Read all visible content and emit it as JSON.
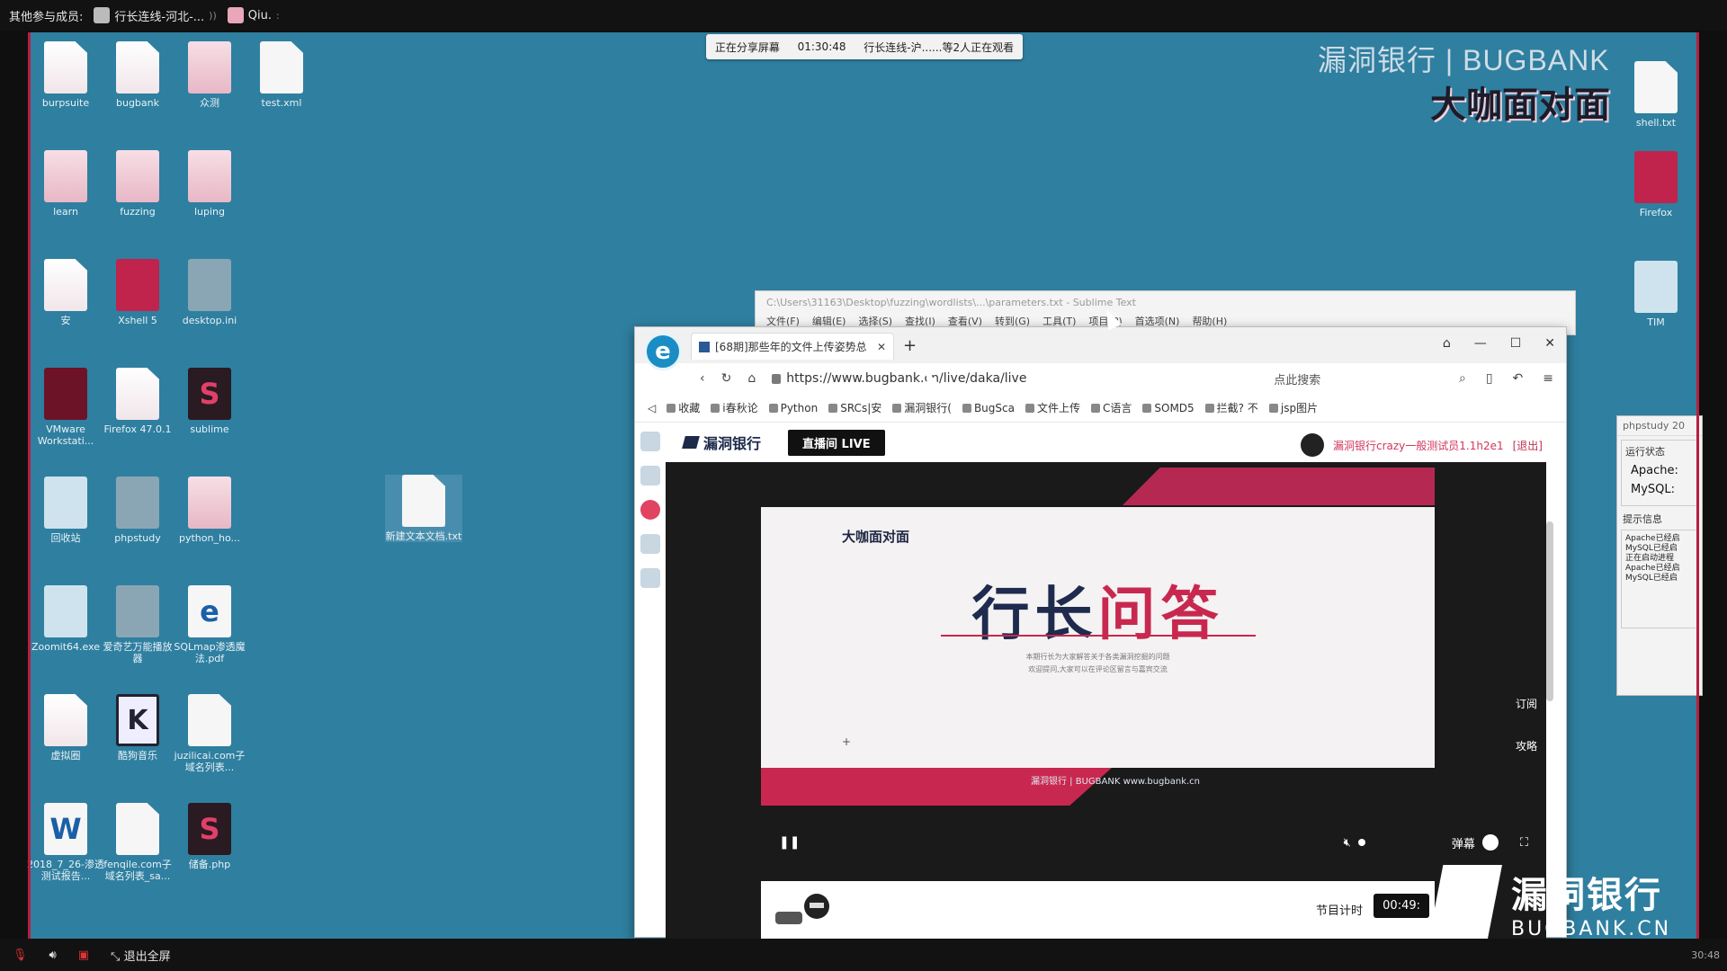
{
  "topbar": {
    "others_label": "其他参与成员:",
    "members": [
      {
        "name": "行长连线-河北-..."
      },
      {
        "name": "Qiu."
      }
    ]
  },
  "share_banner": {
    "status": "正在分享屏幕",
    "elapsed": "01:30:48",
    "info": "行长连线-沪......等2人正在观看"
  },
  "desktop_icons": [
    {
      "label": "burpsuite",
      "kind": "g-file"
    },
    {
      "label": "bugbank",
      "kind": "g-file"
    },
    {
      "label": "众测",
      "kind": "g-folder"
    },
    {
      "label": "test.xml",
      "kind": "g-white"
    },
    {
      "label": "learn",
      "kind": "g-folder"
    },
    {
      "label": "fuzzing",
      "kind": "g-folder"
    },
    {
      "label": "luping",
      "kind": "g-folder"
    },
    {
      "label": "安",
      "kind": "g-file"
    },
    {
      "label": "Xshell 5",
      "kind": "g-red"
    },
    {
      "label": "desktop.ini",
      "kind": "g-gray"
    },
    {
      "label": "VMware Workstati...",
      "kind": "g-vm"
    },
    {
      "label": "Firefox 47.0.1",
      "kind": "g-file"
    },
    {
      "label": "sublime",
      "kind": "g-dark"
    },
    {
      "label": "回收站",
      "kind": "g-blue"
    },
    {
      "label": "phpstudy",
      "kind": "g-gray"
    },
    {
      "label": "python_ho...",
      "kind": "g-folder"
    },
    {
      "label": "Zoomit64.exe",
      "kind": "g-blue"
    },
    {
      "label": "爱奇艺万能播放器",
      "kind": "g-gray"
    },
    {
      "label": "SQLmap渗透魔法.pdf",
      "kind": "g-e"
    },
    {
      "label": "虚拟圈",
      "kind": "g-file"
    },
    {
      "label": "酷狗音乐",
      "kind": "g-k"
    },
    {
      "label": "juzilicai.com子域名列表...",
      "kind": "g-white"
    },
    {
      "label": "2018_7_26-渗透测试报告...",
      "kind": "g-w"
    },
    {
      "label": "fenqile.com子域名列表_sa...",
      "kind": "g-white"
    },
    {
      "label": "储备.php",
      "kind": "g-dark"
    },
    {
      "label": "新建文本文档.txt",
      "kind": "g-white"
    },
    {
      "label": "shell.txt",
      "kind": "g-white"
    },
    {
      "label": "Firefox",
      "kind": "g-red"
    },
    {
      "label": "TIM",
      "kind": "g-blue"
    }
  ],
  "brand_overlay": {
    "top": "漏洞银行 | BUGBANK",
    "sub": "大咖面对面"
  },
  "sublime": {
    "title": "C:\\Users\\31163\\Desktop\\fuzzing\\wordlists\\...\\parameters.txt - Sublime Text",
    "menu": [
      "文件(F)",
      "编辑(E)",
      "选择(S)",
      "查找(I)",
      "查看(V)",
      "转到(G)",
      "工具(T)",
      "项目(P)",
      "首选项(N)",
      "帮助(H)"
    ]
  },
  "phpstudy": {
    "title": "phpstudy 20",
    "status_label": "运行状态",
    "apache": "Apache:",
    "mysql": "MySQL:",
    "tips_label": "提示信息",
    "log": [
      "Apache已经启",
      "MySQL已经启",
      "正在启动进程",
      "Apache已经启",
      "MySQL已经启"
    ]
  },
  "browser": {
    "tab_title": "[68期]那些年的文件上传姿势总",
    "url": "https://www.bugbank.cn/live/daka/live",
    "search_placeholder": "点此搜索",
    "bookmarks": [
      "收藏",
      "i春秋论",
      "Python",
      "SRCs|安",
      "漏洞银行(",
      "BugSca",
      "文件上传",
      "C语言",
      "SOMD5",
      "拦截? 不",
      "jsp图片"
    ],
    "site": {
      "logo": "漏洞银行",
      "live_button": "直播间 LIVE",
      "user_name": "漏洞银行crazy一般测试员1.1h2e1",
      "logout": "[退出]",
      "slide_small": "大咖面对面",
      "slide_title_a": "行长",
      "slide_title_b": "问答",
      "slide_sub1": "本期行长为大家解答关于各类漏洞挖掘的问题",
      "slide_sub2": "欢迎提问,大家可以在评论区留言与嘉宾交流",
      "footer_logo": "漏洞银行 | BUGBANK www.bugbank.cn",
      "side_subscribe": "订阅",
      "side_guide": "攻略",
      "barrage": "弹幕",
      "program_timer_label": "节目计时",
      "program_timer": "00:49:"
    }
  },
  "watermark": {
    "cn": "漏洞银行",
    "en": "BUGBANK.CN"
  },
  "botbar": {
    "exit_full": "退出全屏",
    "time": "30:48"
  }
}
